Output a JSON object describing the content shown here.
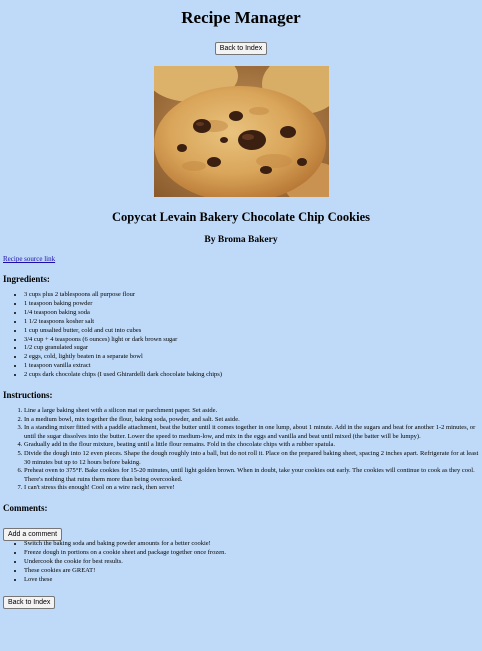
{
  "header": {
    "title": "Recipe Manager",
    "back_label": "Back to Index"
  },
  "hero": {
    "alt": "Chocolate chip cookies",
    "icon": "cookie-photo"
  },
  "recipe": {
    "title": "Copycat Levain Bakery Chocolate Chip Cookies",
    "author": "By Broma Bakery",
    "source_link_label": "Recipe source link"
  },
  "ingredients": {
    "heading": "Ingredients:",
    "items": [
      "3 cups plus 2 tablespoons all purpose flour",
      "1 teaspoon baking powder",
      "1/4 teaspoon baking soda",
      "1 1/2 teaspoons kosher salt",
      "1 cup unsalted butter, cold and cut into cubes",
      "3/4 cup + 4 teaspoons (6 ounces) light or dark brown sugar",
      "1/2 cup granulated sugar",
      "2 eggs, cold, lightly beaten in a separate bowl",
      "1 teaspoon vanilla extract",
      "2 cups dark chocolate chips (I used Ghirardelli dark chocolate baking chips)"
    ]
  },
  "instructions": {
    "heading": "Instructions:",
    "steps": [
      "Line a large baking sheet with a silicon mat or parchment paper. Set aside.",
      "In a medium bowl, mix together the flour, baking soda, powder, and salt. Set aside.",
      "In a standing mixer fitted with a paddle attachment, beat the butter until it comes together in one lump, about 1 minute. Add in the sugars and beat for another 1-2 minutes, or until the sugar dissolves into the butter. Lower the speed to medium-low, and mix in the eggs and vanilla and beat until mixed (the batter will be lumpy).",
      "Gradually add in the flour mixture, beating until a little flour remains. Fold in the chocolate chips with a rubber spatula.",
      "Divide the dough into 12 even pieces. Shape the dough roughly into a ball, but do not roll it. Place on the prepared baking sheet, spacing 2 inches apart. Refrigerate for at least 30 minutes but up to 12 hours before baking.",
      "Preheat oven to 375°F. Bake cookies for 15-20 minutes, until light golden brown. When in doubt, take your cookies out early. The cookies will continue to cook as they cool. There's nothing that ruins them more than being overcooked.",
      "I can't stress this enough! Cool on a wire rack, then serve!"
    ]
  },
  "comments": {
    "heading": "Comments:",
    "add_label": "Add a comment",
    "items": [
      "Switch the baking soda and baking powder amounts for a better cookie!",
      "Freeze dough in portions on a cookie sheet and package together once frozen.",
      "Undercook the cookie for best results.",
      "These cookies are GREAT!",
      "Love these"
    ]
  },
  "footer": {
    "back_label": "Back to Index"
  },
  "colors": {
    "background": "#bfdaf8",
    "link": "#1a0dab"
  }
}
